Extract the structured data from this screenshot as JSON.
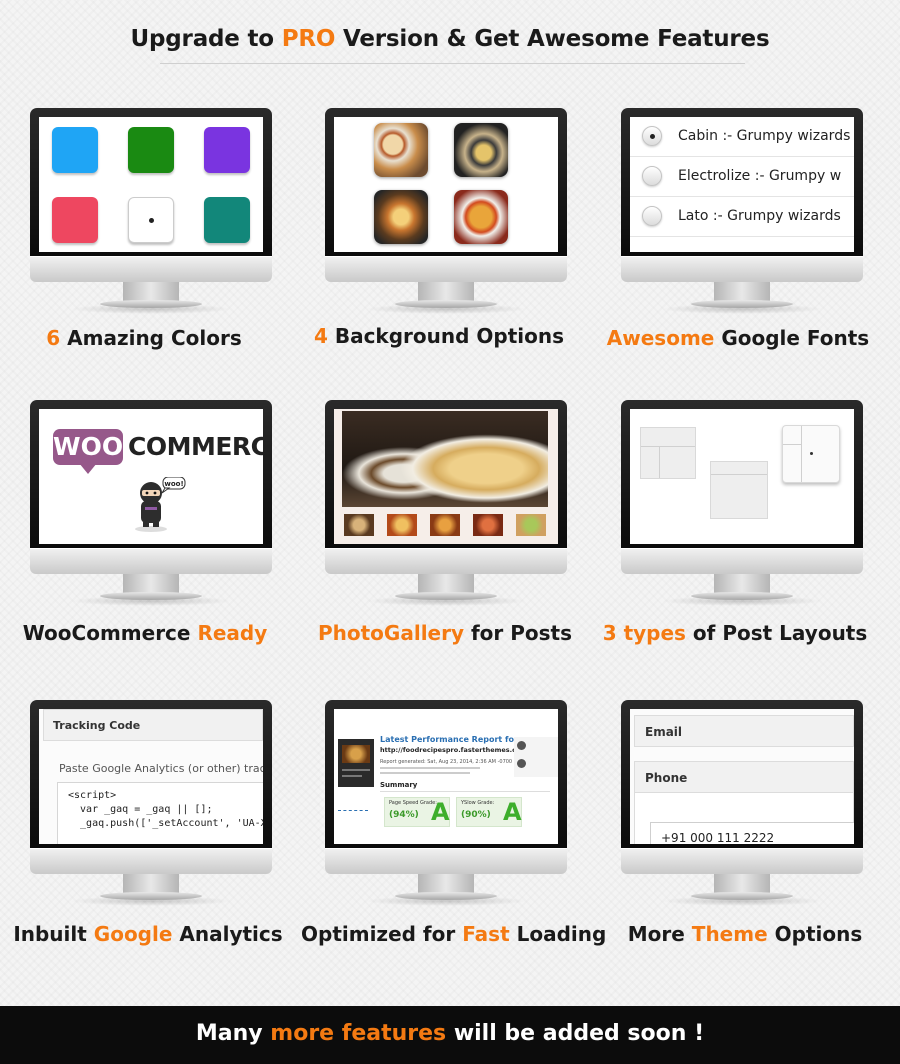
{
  "header": {
    "pre": "Upgrade to ",
    "accent": "PRO",
    "post": " Version & Get Awesome Features"
  },
  "features": [
    {
      "accent_pre": "6",
      "text": " Amazing Colors",
      "accent_post": ""
    },
    {
      "accent_pre": "4",
      "text": " Background Options",
      "accent_post": ""
    },
    {
      "accent_pre": "Awesome",
      "text": " Google Fonts",
      "accent_post": ""
    },
    {
      "accent_pre": "",
      "text": "WooCommerce ",
      "accent_post": "Ready"
    },
    {
      "accent_pre": "PhotoGallery",
      "text": " for Posts",
      "accent_post": ""
    },
    {
      "accent_pre": "3 types",
      "text": " of Post Layouts",
      "accent_post": ""
    },
    {
      "pre": "Inbuilt ",
      "accent": "Google",
      "post": " Analytics"
    },
    {
      "pre": "Optimized for ",
      "accent": "Fast",
      "post": " Loading"
    },
    {
      "pre": "More ",
      "accent": "Theme",
      "post": " Options"
    }
  ],
  "colors_screen": {
    "swatches": [
      "#1fa5f5",
      "#1a8a12",
      "#7a34e0",
      "#ee4760",
      "#ffffff",
      "#12877a"
    ]
  },
  "fonts_screen": {
    "rows": [
      {
        "label": "Cabin :- Grumpy wizards",
        "selected": true
      },
      {
        "label": "Electrolize :- Grumpy w",
        "selected": false
      },
      {
        "label": "Lato :- Grumpy wizards",
        "selected": false
      }
    ]
  },
  "woo_screen": {
    "badge": "WOO",
    "word": "COMMERCE",
    "ninja_tag": "woo!"
  },
  "analytics_screen": {
    "title": "Tracking Code",
    "description": "Paste Google Analytics (or other) tracking",
    "code_lines": [
      "<script>",
      "  var _gaq = _gaq || [];",
      "  _gaq.push(['_setAccount', 'UA-X"
    ]
  },
  "speed_screen": {
    "report_title": "Latest Performance Report for:",
    "report_url": "http://foodrecipespro.fasterthemes.com/",
    "generated": "Report generated:  Sat, Aug 23, 2014, 2:36 AM -0700",
    "summary": "Summary",
    "pagespeed_label": "Page Speed Grade:",
    "pagespeed_value": "(94%)",
    "yslow_label": "YSlow Grade:",
    "yslow_value": "(90%)",
    "grade": "A"
  },
  "options_screen": {
    "email_label": "Email",
    "phone_label": "Phone",
    "phone_value": "+91 000 111 2222"
  },
  "footer": {
    "pre": "Many ",
    "accent": "more features",
    "post": " will be added soon !"
  },
  "accent_color": "#f47a12"
}
